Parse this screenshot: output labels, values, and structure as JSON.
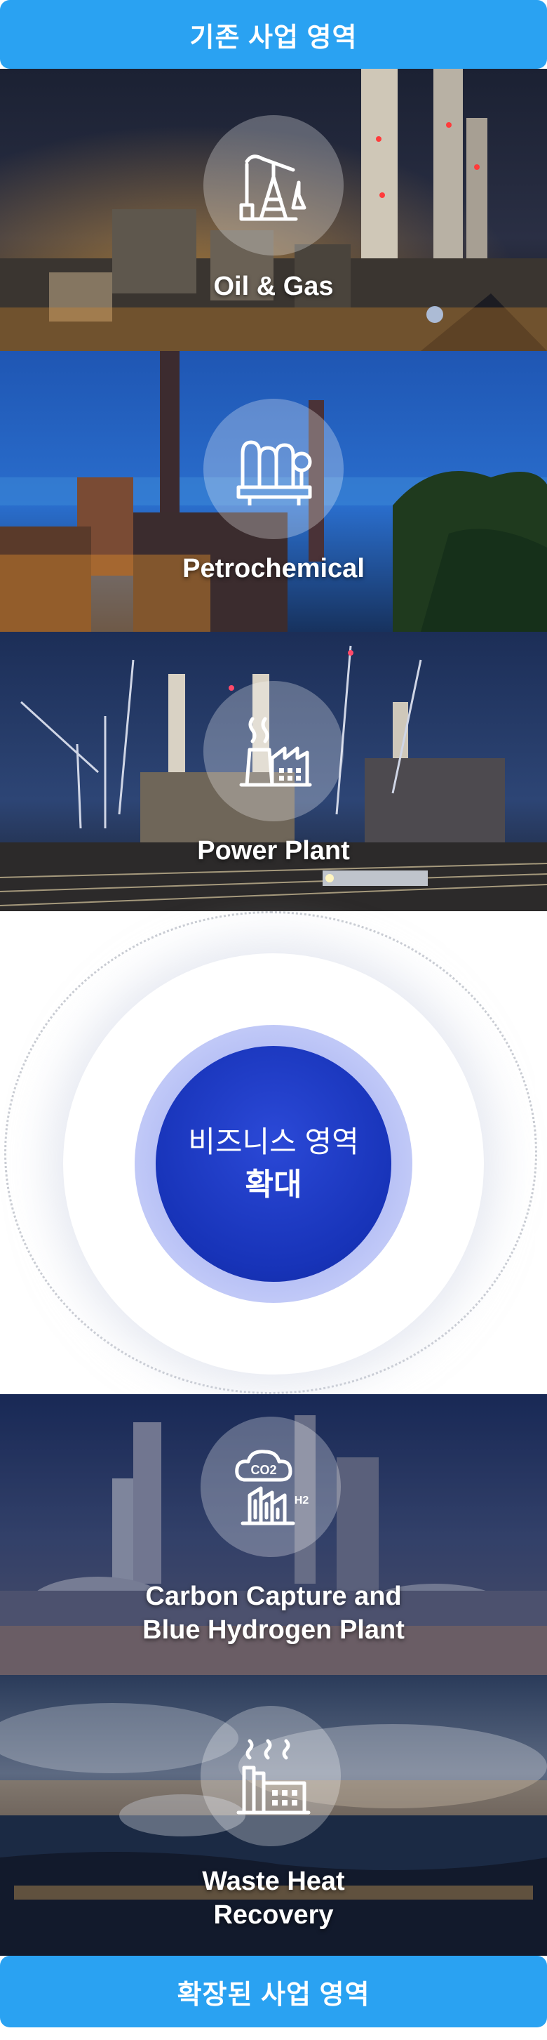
{
  "header": {
    "title": "기존 사업 영역"
  },
  "existing_areas": [
    {
      "label": "Oil & Gas",
      "icon": "oil-pump-icon"
    },
    {
      "label": "Petrochemical",
      "icon": "refinery-icon"
    },
    {
      "label": "Power Plant",
      "icon": "factory-icon"
    }
  ],
  "center": {
    "line1": "비즈니스 영역",
    "line2": "확대",
    "color": "#1733b8"
  },
  "expanded_areas": [
    {
      "label_line1": "Carbon Capture and",
      "label_line2": "Blue Hydrogen Plant",
      "icon": "co2-h2-plant-icon",
      "icon_text_co2": "CO2",
      "icon_text_h2": "H2"
    },
    {
      "label_line1": "Waste Heat",
      "label_line2": "Recovery",
      "icon": "heat-recovery-icon"
    }
  ],
  "footer": {
    "title": "확장된 사업 영역"
  },
  "colors": {
    "bar": "#2aa2f2",
    "core": "#1733b8",
    "glow": "#b9c2f6"
  }
}
